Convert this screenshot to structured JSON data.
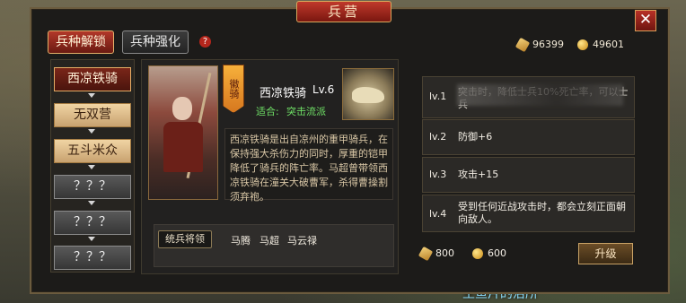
{
  "window": {
    "title": "兵营"
  },
  "tabs": [
    {
      "label": "兵种解锁"
    },
    {
      "label": "兵种强化"
    }
  ],
  "help_icon": "?",
  "resources": [
    {
      "icon": "copper-ingot-icon",
      "value": "96399"
    },
    {
      "icon": "gold-coin-icon",
      "value": "49601"
    }
  ],
  "units": [
    {
      "label": "西凉铁骑",
      "state": "selected"
    },
    {
      "label": "无双营",
      "state": "normal"
    },
    {
      "label": "五斗米众",
      "state": "normal"
    },
    {
      "label": "？？？",
      "state": "locked"
    },
    {
      "label": "？？？",
      "state": "locked"
    },
    {
      "label": "？？？",
      "state": "locked"
    }
  ],
  "detail": {
    "banner_text": "徽骑",
    "name": "西凉铁骑",
    "level": "Lv.6",
    "suit_label": "适合:",
    "suit_value": "突击流派",
    "description": "西凉铁骑是出自凉州的重甲骑兵，在保持强大杀伤力的同时，厚重的铠甲降低了骑兵的阵亡率。马超曾带领西凉铁骑在潼关大破曹军，杀得曹操割须弃袍。",
    "generals_label": "统兵将领",
    "generals": [
      "马腾",
      "马超",
      "马云禄"
    ]
  },
  "levels": [
    {
      "tag": "lv.1",
      "text": "突击时，降低士兵10%死亡率，可以士兵"
    },
    {
      "tag": "lv.2",
      "text": "防御+6"
    },
    {
      "tag": "lv.3",
      "text": "攻击+15"
    },
    {
      "tag": "lv.4",
      "text": "受到任何近战攻击时，都会立刻正面朝向敌人。"
    }
  ],
  "upgrade": {
    "cost_copper": "800",
    "cost_gold": "600",
    "button_label": "升级"
  },
  "footer_text": "生鱼片的治所",
  "colors": {
    "accent_red": "#b83127",
    "gold": "#e5ad65",
    "green_text": "#6fe066"
  }
}
